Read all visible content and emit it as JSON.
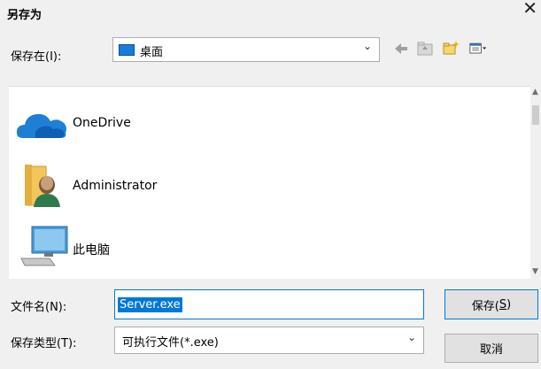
{
  "dialog": {
    "title": "另存为",
    "close_glyph": "✕"
  },
  "location": {
    "label": "保存在(I):",
    "value": "桌面"
  },
  "toolbar": {
    "icons": [
      "back-arrow-icon",
      "up-folder-icon",
      "new-folder-icon",
      "view-menu-icon"
    ]
  },
  "items": [
    {
      "name": "OneDrive",
      "icon": "onedrive-cloud-icon"
    },
    {
      "name": "Administrator",
      "icon": "user-folder-icon"
    },
    {
      "name": "此电脑",
      "icon": "this-pc-icon"
    }
  ],
  "filename": {
    "label": "文件名(N):",
    "value": "Server.exe"
  },
  "filetype": {
    "label": "保存类型(T):",
    "value": "可执行文件(*.exe)"
  },
  "buttons": {
    "save_main": "保存(",
    "save_key": "S",
    "save_end": ")",
    "cancel": "取消"
  },
  "colors": {
    "accent": "#0078d7",
    "dialog_bg": "#f0f0f0"
  }
}
